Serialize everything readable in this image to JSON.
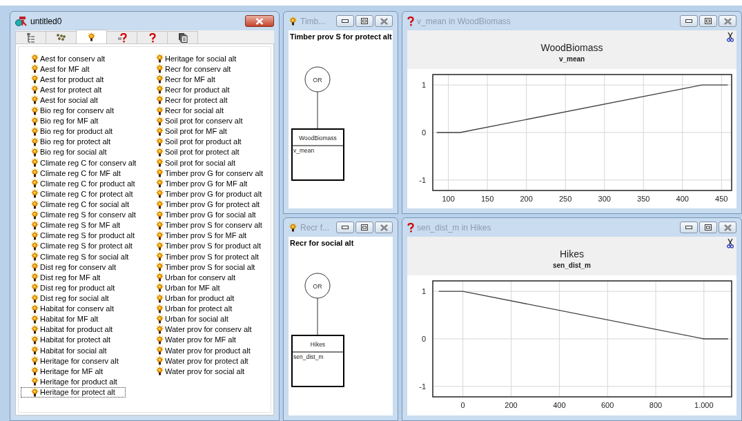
{
  "main_window": {
    "title": "untitled0",
    "tabs": [
      {
        "kind": "tree",
        "selected": false
      },
      {
        "kind": "nodes",
        "selected": false
      },
      {
        "kind": "bulb",
        "selected": true
      },
      {
        "kind": "question-list",
        "selected": false
      },
      {
        "kind": "question",
        "selected": false
      },
      {
        "kind": "pages",
        "selected": false
      }
    ],
    "items": [
      {
        "label": "Aest for conserv alt",
        "selected": false
      },
      {
        "label": "Aest for MF alt",
        "selected": false
      },
      {
        "label": "Aest for product alt",
        "selected": false
      },
      {
        "label": "Aest for protect alt",
        "selected": false
      },
      {
        "label": "Aest for social alt",
        "selected": false
      },
      {
        "label": "Bio reg for conserv alt",
        "selected": false
      },
      {
        "label": "Bio reg for MF alt",
        "selected": false
      },
      {
        "label": "Bio reg for product alt",
        "selected": false
      },
      {
        "label": "Bio reg for protect alt",
        "selected": false
      },
      {
        "label": "Bio reg for social alt",
        "selected": false
      },
      {
        "label": "Climate reg C for conserv alt",
        "selected": false
      },
      {
        "label": "Climate reg C for MF alt",
        "selected": false
      },
      {
        "label": "Climate reg C for product alt",
        "selected": false
      },
      {
        "label": "Climate reg C for protect alt",
        "selected": false
      },
      {
        "label": "Climate reg C for social alt",
        "selected": false
      },
      {
        "label": "Climate reg S for conserv alt",
        "selected": false
      },
      {
        "label": "Climate reg S for MF alt",
        "selected": false
      },
      {
        "label": "Climate reg S for product alt",
        "selected": false
      },
      {
        "label": "Climate reg S for protect alt",
        "selected": false
      },
      {
        "label": "Climate reg S for social alt",
        "selected": false
      },
      {
        "label": "Dist reg for conserv alt",
        "selected": false
      },
      {
        "label": "Dist reg for MF alt",
        "selected": false
      },
      {
        "label": "Dist reg for product alt",
        "selected": false
      },
      {
        "label": "Dist reg for social alt",
        "selected": false
      },
      {
        "label": "Habitat for conserv alt",
        "selected": false
      },
      {
        "label": "Habitat for MF alt",
        "selected": false
      },
      {
        "label": "Habitat for product alt",
        "selected": false
      },
      {
        "label": "Habitat for protect alt",
        "selected": false
      },
      {
        "label": "Habitat for social alt",
        "selected": false
      },
      {
        "label": "Heritage for conserv alt",
        "selected": false
      },
      {
        "label": "Heritage for MF alt",
        "selected": false
      },
      {
        "label": "Heritage for product alt",
        "selected": false
      },
      {
        "label": "Heritage for protect alt",
        "selected": true
      },
      {
        "label": "Heritage for social alt",
        "selected": false
      },
      {
        "label": "Recr for conserv alt",
        "selected": false
      },
      {
        "label": "Recr for MF alt",
        "selected": false
      },
      {
        "label": "Recr for product alt",
        "selected": false
      },
      {
        "label": "Recr for protect alt",
        "selected": false
      },
      {
        "label": "Recr for social alt",
        "selected": false
      },
      {
        "label": "Soil prot for conserv alt",
        "selected": false
      },
      {
        "label": "Soil prot for MF alt",
        "selected": false
      },
      {
        "label": "Soil prot for product alt",
        "selected": false
      },
      {
        "label": "Soil prot for protect alt",
        "selected": false
      },
      {
        "label": "Soil prot for social alt",
        "selected": false
      },
      {
        "label": "Timber prov G for conserv alt",
        "selected": false
      },
      {
        "label": "Timber prov G for MF alt",
        "selected": false
      },
      {
        "label": "Timber prov G for product alt",
        "selected": false
      },
      {
        "label": "Timber prov G for protect alt",
        "selected": false
      },
      {
        "label": "Timber prov G for social alt",
        "selected": false
      },
      {
        "label": "Timber prov S for conserv alt",
        "selected": false
      },
      {
        "label": "Timber prov S for MF alt",
        "selected": false
      },
      {
        "label": "Timber prov S for product alt",
        "selected": false
      },
      {
        "label": "Timber prov S for protect alt",
        "selected": false
      },
      {
        "label": "Timber prov S for social alt",
        "selected": false
      },
      {
        "label": "Urban for conserv alt",
        "selected": false
      },
      {
        "label": "Urban for MF alt",
        "selected": false
      },
      {
        "label": "Urban for product alt",
        "selected": false
      },
      {
        "label": "Urban for protect alt",
        "selected": false
      },
      {
        "label": "Urban for social alt",
        "selected": false
      },
      {
        "label": "Water prov for conserv alt",
        "selected": false
      },
      {
        "label": "Water prov for MF alt",
        "selected": false
      },
      {
        "label": "Water prov for product alt",
        "selected": false
      },
      {
        "label": "Water prov for protect alt",
        "selected": false
      },
      {
        "label": "Water prov for social alt",
        "selected": false
      }
    ]
  },
  "tree_windows": [
    {
      "title": "Timb...",
      "heading": "Timber prov S for protect alt",
      "operator": "OR",
      "node": {
        "title": "WoodBiomass",
        "attribute": "v_mean"
      }
    },
    {
      "title": "Recr f...",
      "heading": "Recr for social alt",
      "operator": "OR",
      "node": {
        "title": "Hikes",
        "attribute": "sen_dist_m"
      }
    }
  ],
  "chart_windows": [
    {
      "title": "v_mean in WoodBiomass",
      "subtitle": "v_mean",
      "chart_data": {
        "type": "line",
        "grid": true,
        "title": "WoodBiomass",
        "x": [
          85,
          115,
          425,
          458
        ],
        "series": [
          {
            "color": "#404040",
            "values": [
              0,
              0,
              1,
              1
            ]
          }
        ],
        "xlim": [
          80,
          463
        ],
        "ylim": [
          -1.22,
          1.22
        ],
        "xticks": [
          100,
          150,
          200,
          250,
          300,
          350,
          400,
          450
        ],
        "yticks": [
          -1,
          0,
          1
        ]
      }
    },
    {
      "title": "sen_dist_m in Hikes",
      "subtitle": "sen_dist_m",
      "chart_data": {
        "type": "line",
        "grid": true,
        "title": "Hikes",
        "x": [
          -100,
          0,
          1000,
          1100
        ],
        "series": [
          {
            "color": "#404040",
            "values": [
              1,
              1,
              0,
              0
            ]
          }
        ],
        "xlim": [
          -125,
          1115
        ],
        "ylim": [
          -1.22,
          1.22
        ],
        "xticks": [
          0,
          200,
          400,
          600,
          800,
          {
            "value": 1000,
            "label": "1.000"
          }
        ],
        "yticks": [
          -1,
          0,
          1
        ]
      }
    }
  ]
}
